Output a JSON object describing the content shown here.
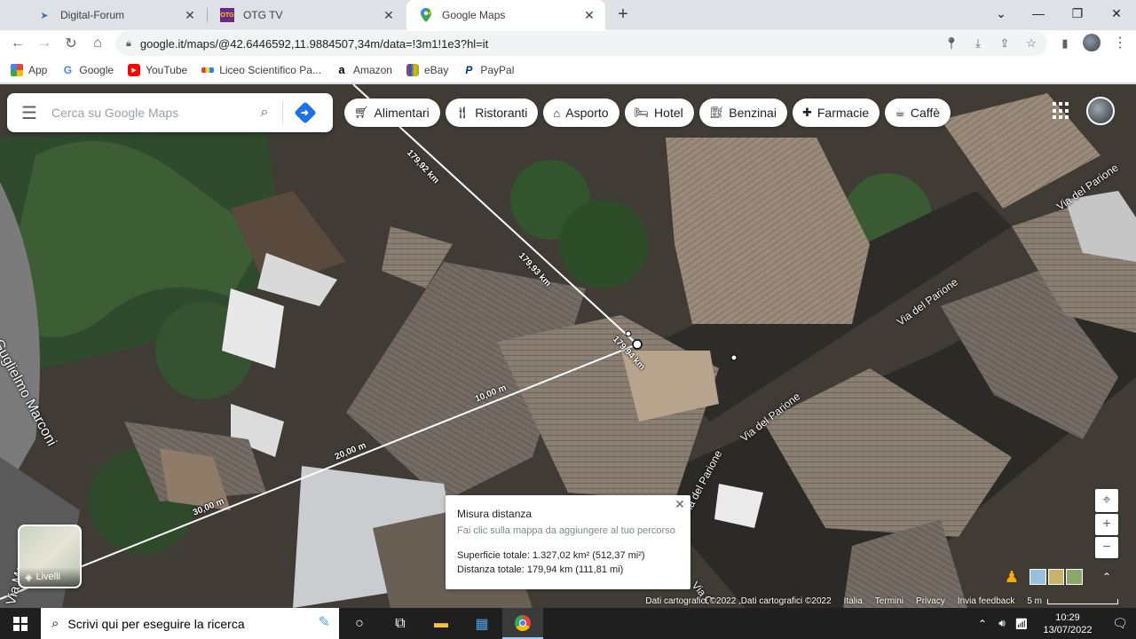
{
  "browser": {
    "tabs": [
      {
        "title": "Digital-Forum",
        "active": false
      },
      {
        "title": "OTG TV",
        "active": false
      },
      {
        "title": "Google Maps",
        "active": true
      }
    ],
    "url": "google.it/maps/@42.6446592,11.9884507,34m/data=!3m1!1e3?hl=it",
    "bookmarks": [
      "App",
      "Google",
      "YouTube",
      "Liceo Scientifico Pa...",
      "Amazon",
      "eBay",
      "PayPal"
    ]
  },
  "map": {
    "search_placeholder": "Cerca su Google Maps",
    "chips": [
      {
        "label": "Alimentari",
        "icon": "cart-icon"
      },
      {
        "label": "Ristoranti",
        "icon": "fork-knife-icon"
      },
      {
        "label": "Asporto",
        "icon": "takeout-icon"
      },
      {
        "label": "Hotel",
        "icon": "bed-icon"
      },
      {
        "label": "Benzinai",
        "icon": "fuel-icon"
      },
      {
        "label": "Farmacie",
        "icon": "pharmacy-icon"
      },
      {
        "label": "Caffè",
        "icon": "coffee-icon"
      }
    ],
    "streets": {
      "parione_top": "Via del Parione",
      "parione_mid": "Via del Parione",
      "parione_low": "Via del Parione",
      "parione_bottom": "Via del Parione",
      "marconi": "Guglielmo Marconi",
      "marconi_low": "Via Marconi",
      "via_c": "Via C"
    },
    "measure_labels": {
      "km1": "179,92 km",
      "km2": "179,93 km",
      "km3": "179,94 km",
      "m10": "10,00 m",
      "m20": "20,00 m",
      "m30": "30,00 m"
    },
    "popup": {
      "title": "Misura distanza",
      "hint": "Fai clic sulla mappa da aggiungere al tuo percorso",
      "area": "Superficie totale: 1.327,02 km² (512,37 mi²)",
      "distance": "Distanza totale: 179,94 km (111,81 mi)"
    },
    "layers_label": "Livelli",
    "footer": {
      "data": "Dati cartografici ©2022 ,Dati cartografici ©2022",
      "country": "Italia",
      "terms": "Termini",
      "privacy": "Privacy",
      "feedback": "Invia feedback",
      "scale": "5 m"
    }
  },
  "taskbar": {
    "search_placeholder": "Scrivi qui per eseguire la ricerca",
    "time": "10:29",
    "date": "13/07/2022"
  },
  "colors": {
    "accent": "#1a73e8",
    "tab_bg": "#dee1e6",
    "taskbar": "#1f1f1f"
  }
}
